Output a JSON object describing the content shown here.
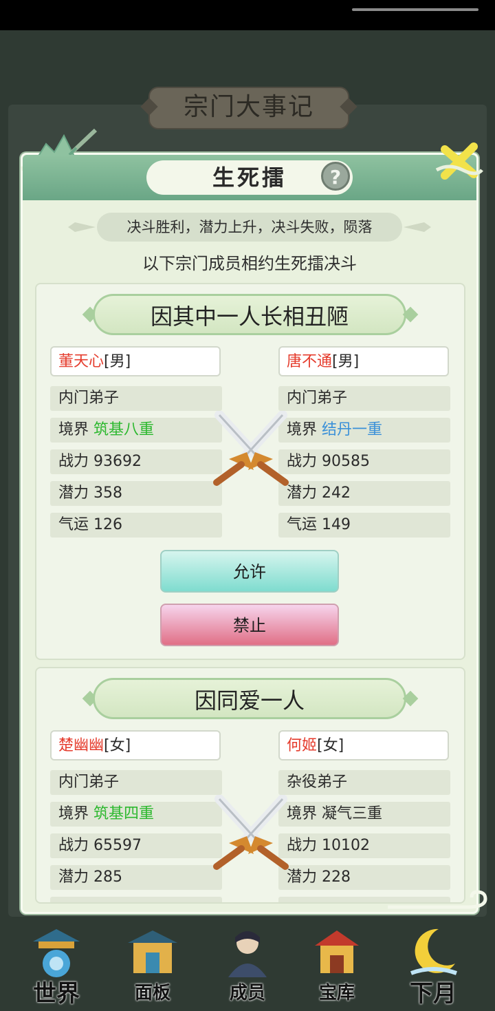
{
  "background": {
    "title": "宗门大事记"
  },
  "dialog": {
    "title": "生死擂",
    "help_icon": "?",
    "rule": "决斗胜利，潜力上升，决斗失败，陨落",
    "subtitle": "以下宗门成员相约生死擂决斗"
  },
  "duels": [
    {
      "reason": "因其中一人长相丑陋",
      "left": {
        "name": "董天心",
        "gender": "[男]",
        "rank": "内门弟子",
        "realm_label": "境界",
        "realm": "筑基八重",
        "realm_color": "#2db82f",
        "power": "战力 93692",
        "potential": "潜力 358",
        "luck": "气运 126"
      },
      "right": {
        "name": "唐不通",
        "gender": "[男]",
        "rank": "内门弟子",
        "realm_label": "境界",
        "realm": "结丹一重",
        "realm_color": "#3a90d8",
        "power": "战力 90585",
        "potential": "潜力 242",
        "luck": "气运 149"
      },
      "allow_label": "允许",
      "deny_label": "禁止"
    },
    {
      "reason": "因同爱一人",
      "left": {
        "name": "楚幽幽",
        "gender": "[女]",
        "rank": "内门弟子",
        "realm_label": "境界",
        "realm": "筑基四重",
        "realm_color": "#2db82f",
        "power": "战力 65597",
        "potential": "潜力 285"
      },
      "right": {
        "name": "何姬",
        "gender": "[女]",
        "rank": "杂役弟子",
        "realm_label": "境界",
        "realm": "凝气三重",
        "realm_color": "#2b2b2b",
        "power": "战力 10102",
        "potential": "潜力 228"
      }
    }
  ],
  "nav": {
    "items": [
      {
        "label": "世界",
        "icon": "world-pagoda-icon"
      },
      {
        "label": "面板",
        "icon": "panel-palace-icon"
      },
      {
        "label": "成员",
        "icon": "members-person-icon"
      },
      {
        "label": "宝库",
        "icon": "treasury-icon"
      },
      {
        "label": "下月",
        "icon": "next-month-moon-icon"
      }
    ]
  }
}
